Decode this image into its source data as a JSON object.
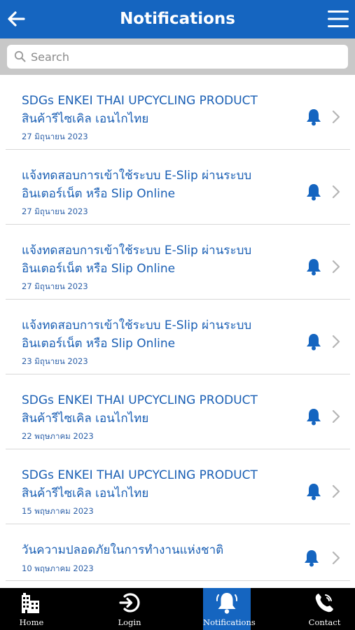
{
  "header": {
    "title": "Notifications",
    "back_icon": "arrow-left-icon",
    "menu_icon": "hamburger-menu-icon"
  },
  "search": {
    "placeholder": "Search",
    "value": "",
    "icon": "search-icon"
  },
  "notifications": [
    {
      "title": "SDGs ENKEI THAI UPCYCLING PRODUCT สินค้ารีไซเคิล เอนไกไทย",
      "date": "27 มิถุนายน 2023"
    },
    {
      "title": "แจ้งทดสอบการเข้าใช้ระบบ E-Slip ผ่านระบบอินเตอร์เน็ต หรือ Slip Online",
      "date": "27 มิถุนายน 2023"
    },
    {
      "title": "แจ้งทดสอบการเข้าใช้ระบบ E-Slip ผ่านระบบอินเตอร์เน็ต หรือ Slip Online",
      "date": "27 มิถุนายน 2023"
    },
    {
      "title": "แจ้งทดสอบการเข้าใช้ระบบ E-Slip ผ่านระบบอินเตอร์เน็ต หรือ Slip Online",
      "date": "23 มิถุนายน 2023"
    },
    {
      "title": "SDGs ENKEI THAI UPCYCLING PRODUCT สินค้ารีไซเคิล เอนไกไทย",
      "date": "22 พฤษภาคม 2023"
    },
    {
      "title": "SDGs ENKEI THAI UPCYCLING PRODUCT สินค้ารีไซเคิล เอนไกไทย",
      "date": "15 พฤษภาคม 2023"
    },
    {
      "title": "วันความปลอดภัยในการทำงานแห่งชาติ",
      "date": "10 พฤษภาคม 2023"
    }
  ],
  "tabbar": {
    "items": [
      {
        "label": "Home",
        "icon": "building-icon",
        "active": false
      },
      {
        "label": "Login",
        "icon": "login-icon",
        "active": false
      },
      {
        "label": "Notifications",
        "icon": "bell-icon",
        "active": true
      },
      {
        "label": "Contact",
        "icon": "phone-icon",
        "active": false
      }
    ]
  },
  "colors": {
    "primary": "#1565c0",
    "search_bar_bg": "#c8c8c8",
    "tabbar_bg": "#000000",
    "title_text": "#1a5fb4",
    "divider": "#d8d8d8"
  }
}
